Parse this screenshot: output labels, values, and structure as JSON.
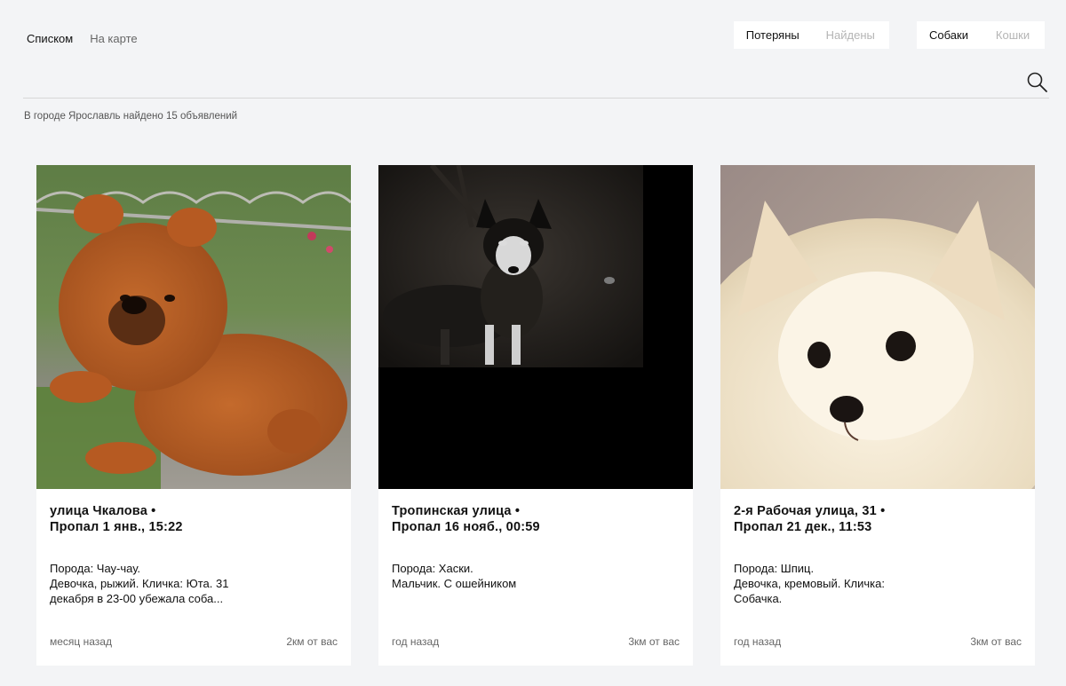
{
  "view_tabs": [
    {
      "label": "Списком",
      "active": true
    },
    {
      "label": "На карте",
      "active": false
    }
  ],
  "status_filter": [
    {
      "label": "Потеряны",
      "active": true
    },
    {
      "label": "Найдены",
      "active": false
    }
  ],
  "species_filter": [
    {
      "label": "Собаки",
      "active": true
    },
    {
      "label": "Кошки",
      "active": false
    }
  ],
  "search": {
    "icon": "search-icon"
  },
  "result_count": "В городе Ярославль найдено 15 объявлений",
  "colors": {
    "background": "#f3f4f6",
    "card": "#ffffff",
    "muted": "#666666",
    "inactive": "#b5b5b5"
  },
  "cards": [
    {
      "location": "улица Чкалова •",
      "lost": "Пропал 1 янв., 15:22",
      "desc": [
        "Порода: Чау-чау.",
        "Девочка, рыжий. Кличка: Юта. 31",
        "декабря в 23-00 убежала соба..."
      ],
      "posted": "месяц назад",
      "distance": "2км от вас"
    },
    {
      "location": "Тропинская улица •",
      "lost": "Пропал 16 нояб., 00:59",
      "desc": [
        "Порода: Хаски.",
        "Мальчик. С ошейником"
      ],
      "posted": "год назад",
      "distance": "3км от вас"
    },
    {
      "location": "2-я Рабочая улица, 31 •",
      "lost": "Пропал 21 дек., 11:53",
      "desc": [
        "Порода: Шпиц.",
        "Девочка, кремовый. Кличка:",
        "Собачка."
      ],
      "posted": "год назад",
      "distance": "3км от вас"
    }
  ]
}
